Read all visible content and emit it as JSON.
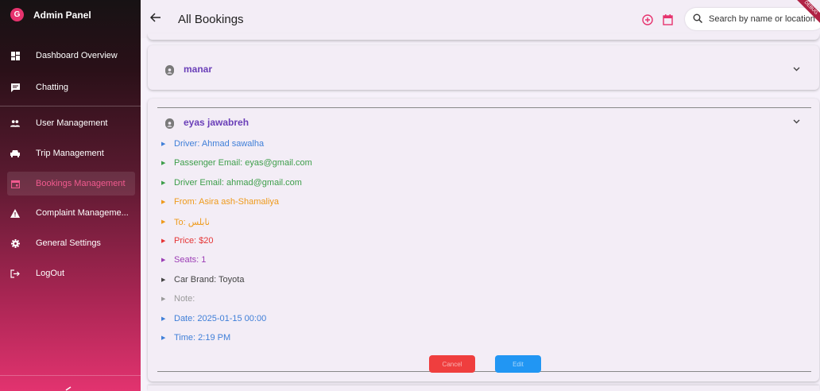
{
  "sidebar": {
    "title": "Admin Panel",
    "logo_letter": "G",
    "items": [
      {
        "label": "Dashboard Overview",
        "icon": "dashboard-icon"
      },
      {
        "label": "Chatting",
        "icon": "chat-icon"
      },
      {
        "label": "User Management",
        "icon": "users-icon"
      },
      {
        "label": "Trip Management",
        "icon": "car-icon"
      },
      {
        "label": "Bookings Management",
        "icon": "calendar-icon"
      },
      {
        "label": "Complaint Manageme...",
        "icon": "warning-icon"
      },
      {
        "label": "General Settings",
        "icon": "gear-icon"
      },
      {
        "label": "LogOut",
        "icon": "logout-icon"
      }
    ],
    "collapse_icon": "chevron-left-icon"
  },
  "header": {
    "title": "All Bookings",
    "search_placeholder": "Search by name or location",
    "debug_banner": "DEBUG"
  },
  "bookings": [
    {
      "name": "manar"
    },
    {
      "name": "eyas jawabreh",
      "details": [
        {
          "text": "Driver: Ahmad sawalha",
          "color": "#3f7fd8"
        },
        {
          "text": "Passenger Email: eyas@gmail.com",
          "color": "#3d9e4a"
        },
        {
          "text": "Driver Email: ahmad@gmail.com",
          "color": "#3d9e4a"
        },
        {
          "text": "From: Asira ash-Shamaliya",
          "color": "#ee9a1a"
        },
        {
          "text": "To: نابلس",
          "color": "#ee9a1a"
        },
        {
          "text": "Price: $20",
          "color": "#e53535"
        },
        {
          "text": "Seats: 1",
          "color": "#9b3cb5"
        },
        {
          "text": "Car Brand: Toyota",
          "color": "#444444"
        },
        {
          "text": "Note:",
          "color": "#9a9a9a"
        },
        {
          "text": "Date: 2025-01-15 00:00",
          "color": "#3f7fd8"
        },
        {
          "text": "Time: 2:19 PM",
          "color": "#3f7fd8"
        }
      ],
      "cancel_label": "Cancel",
      "edit_label": "Edit"
    }
  ],
  "colors": {
    "accent": "#e6336e",
    "cancel": "#ef3e3e",
    "edit": "#2196f3",
    "name": "#6a3fb8"
  }
}
